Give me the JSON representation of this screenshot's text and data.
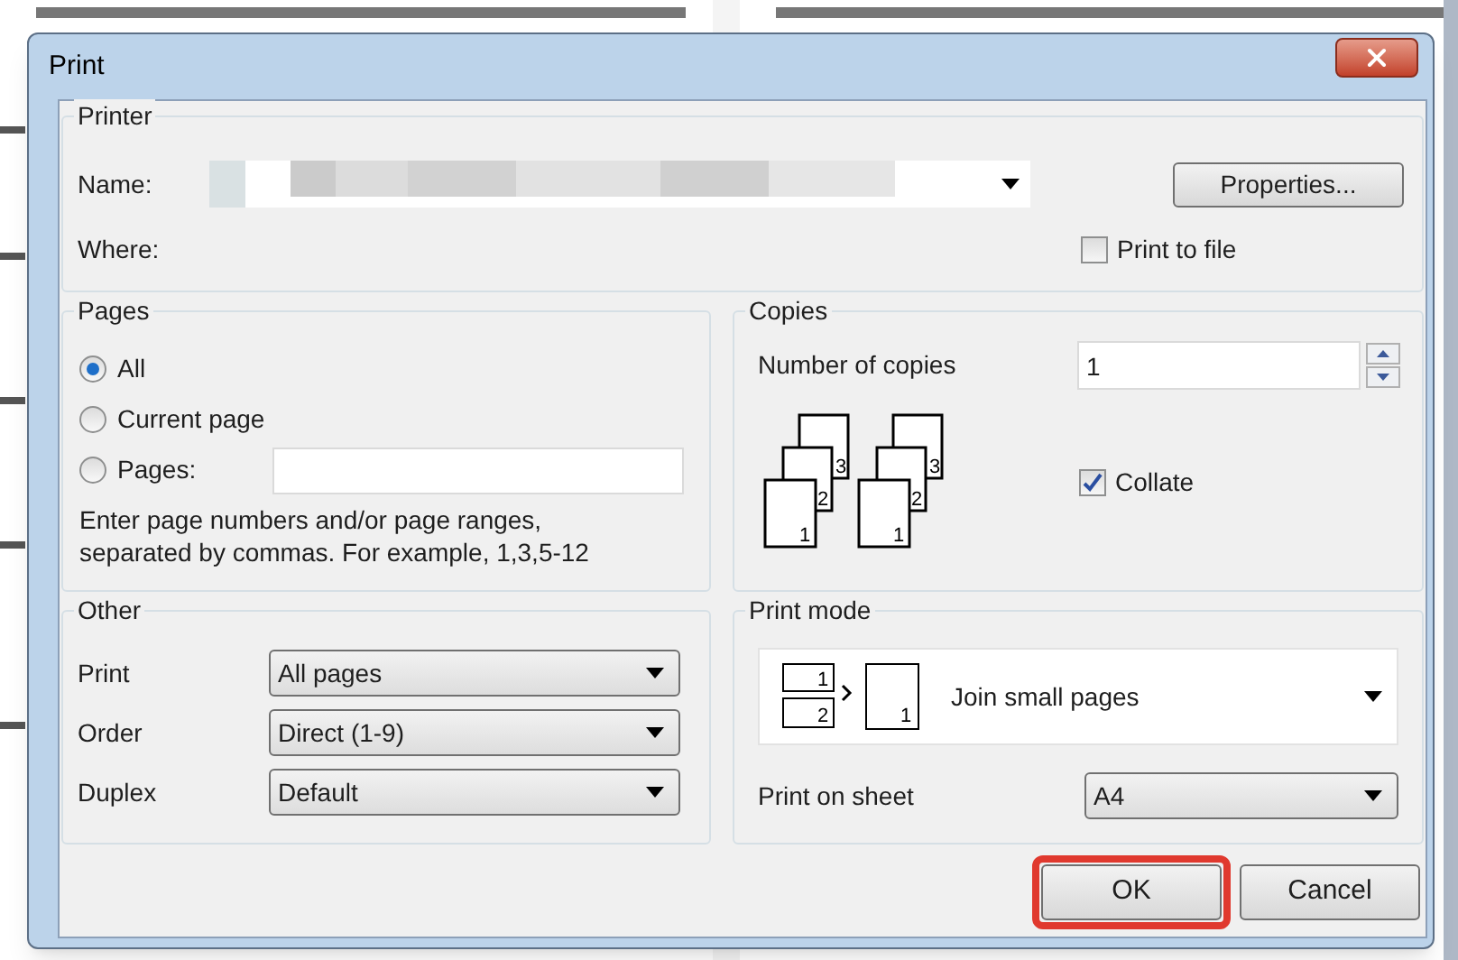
{
  "window": {
    "title": "Print"
  },
  "printer": {
    "title": "Printer",
    "name_label": "Name:",
    "where_label": "Where:",
    "properties": "Properties...",
    "print_to_file": {
      "label": "Print to file",
      "checked": false
    }
  },
  "pages": {
    "title": "Pages",
    "options": [
      {
        "label": "All",
        "selected": true
      },
      {
        "label": "Current page",
        "selected": false
      },
      {
        "label": "Pages:",
        "selected": false
      }
    ],
    "hint": "Enter page numbers and/or page ranges,\nseparated by commas. For example, 1,3,5-12"
  },
  "copies": {
    "title": "Copies",
    "label": "Number of copies",
    "value": "1",
    "stacks": [
      [
        "1",
        "2",
        "3"
      ],
      [
        "1",
        "2",
        "3"
      ]
    ],
    "collate": {
      "label": "Collate",
      "checked": true
    }
  },
  "other": {
    "title": "Other",
    "rows": [
      {
        "label": "Print",
        "value": "All pages"
      },
      {
        "label": "Order",
        "value": "Direct (1-9)"
      },
      {
        "label": "Duplex",
        "value": "Default"
      }
    ]
  },
  "print_mode": {
    "title": "Print mode",
    "diagram_numbers": [
      "1",
      "2",
      "1"
    ],
    "mode": "Join small pages",
    "sheet_label": "Print on sheet",
    "sheet_value": "A4"
  },
  "buttons": [
    {
      "label": "OK",
      "highlighted": true
    },
    {
      "label": "Cancel",
      "highlighted": false
    }
  ]
}
